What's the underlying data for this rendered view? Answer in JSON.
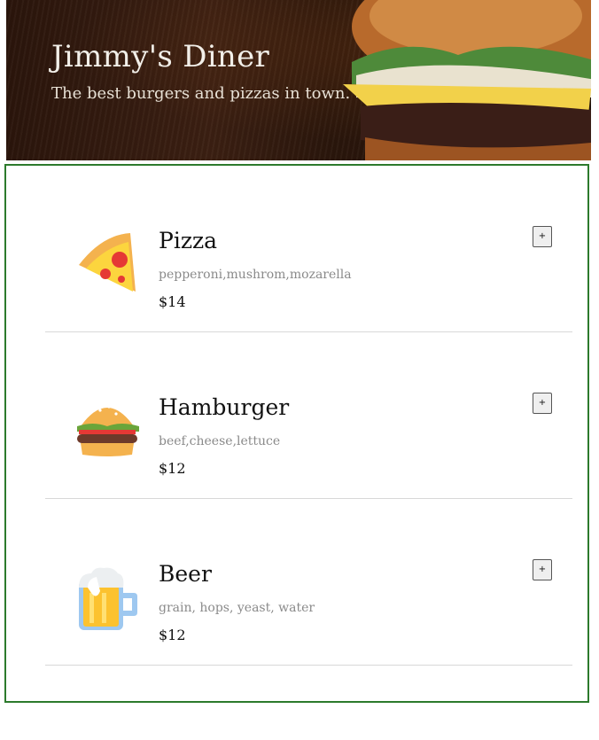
{
  "header": {
    "title": "Jimmy's Diner",
    "subtitle": "The best burgers and pizzas in town."
  },
  "menu": {
    "items": [
      {
        "icon": "pizza-icon",
        "name": "Pizza",
        "ingredients": "pepperoni,mushrom,mozarella",
        "price": "$14",
        "add_label": "+"
      },
      {
        "icon": "hamburger-icon",
        "name": "Hamburger",
        "ingredients": "beef,cheese,lettuce",
        "price": "$12",
        "add_label": "+"
      },
      {
        "icon": "beer-icon",
        "name": "Beer",
        "ingredients": "grain, hops, yeast, water",
        "price": "$12",
        "add_label": "+"
      }
    ]
  },
  "colors": {
    "menu_border": "#2c7a2c",
    "divider": "#d8d8d8",
    "ingredients_text": "#8a8a8a"
  }
}
